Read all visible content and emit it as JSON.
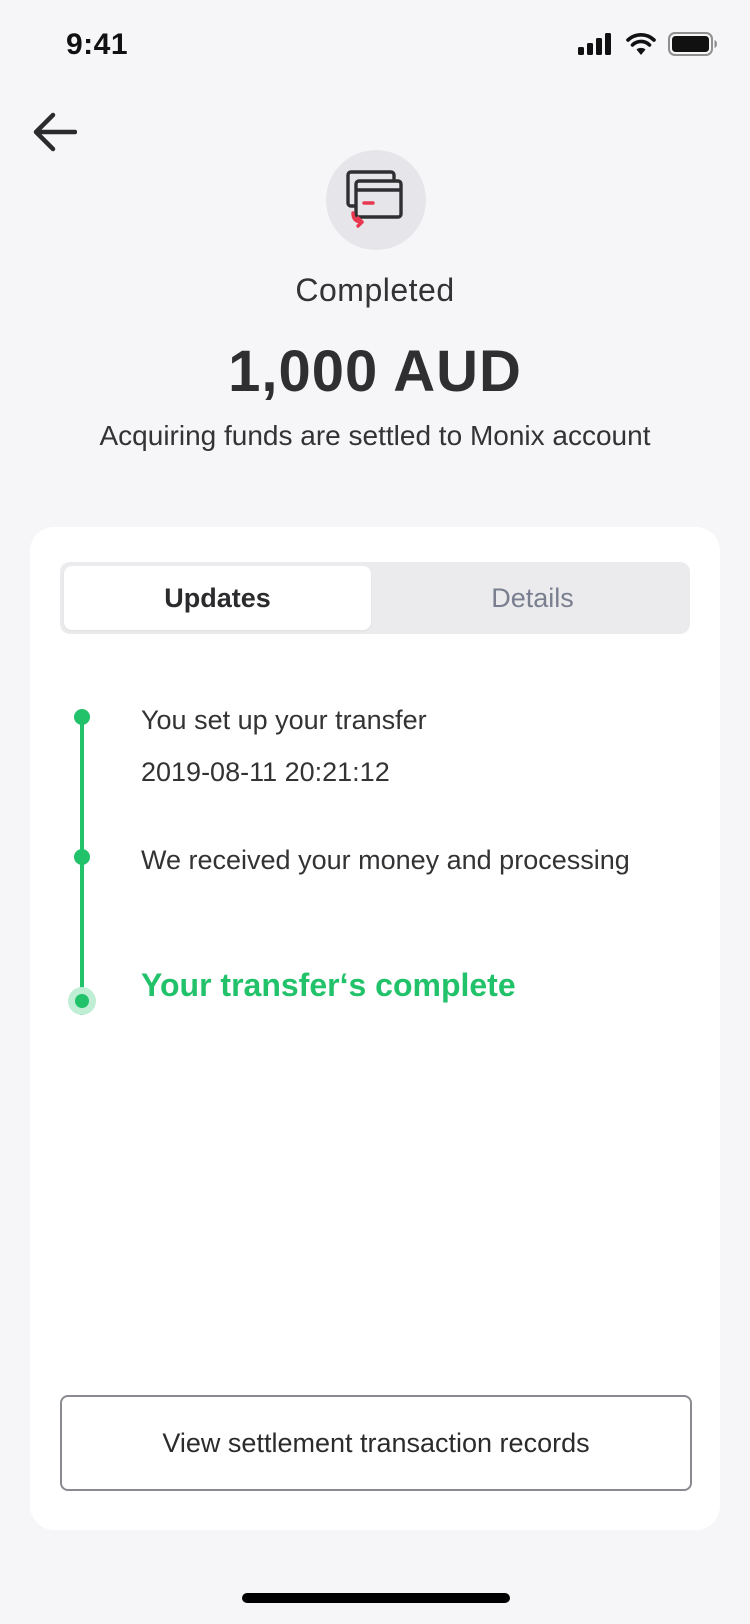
{
  "status_bar": {
    "time": "9:41",
    "icons": [
      "signal-icon",
      "wifi-icon",
      "battery-icon"
    ]
  },
  "header": {
    "back_icon": "arrow-left-icon",
    "hero_icon": "card-refund-icon",
    "status": "Completed",
    "amount": "1,000 AUD",
    "subtitle": "Acquiring funds are settled to Monix account"
  },
  "tabs": [
    {
      "label": "Updates",
      "active": true
    },
    {
      "label": "Details",
      "active": false
    }
  ],
  "timeline": [
    {
      "title": "You set up your transfer",
      "time": "2019-08-11 20:21:12"
    },
    {
      "title": "We received your money and processing"
    },
    {
      "title": "Your transfer‘s complete",
      "current": true
    }
  ],
  "actions": {
    "records_button": "View settlement transaction records"
  },
  "colors": {
    "accent_green": "#22c26a",
    "icon_red": "#e8384f",
    "background": "#f6f6f8"
  }
}
